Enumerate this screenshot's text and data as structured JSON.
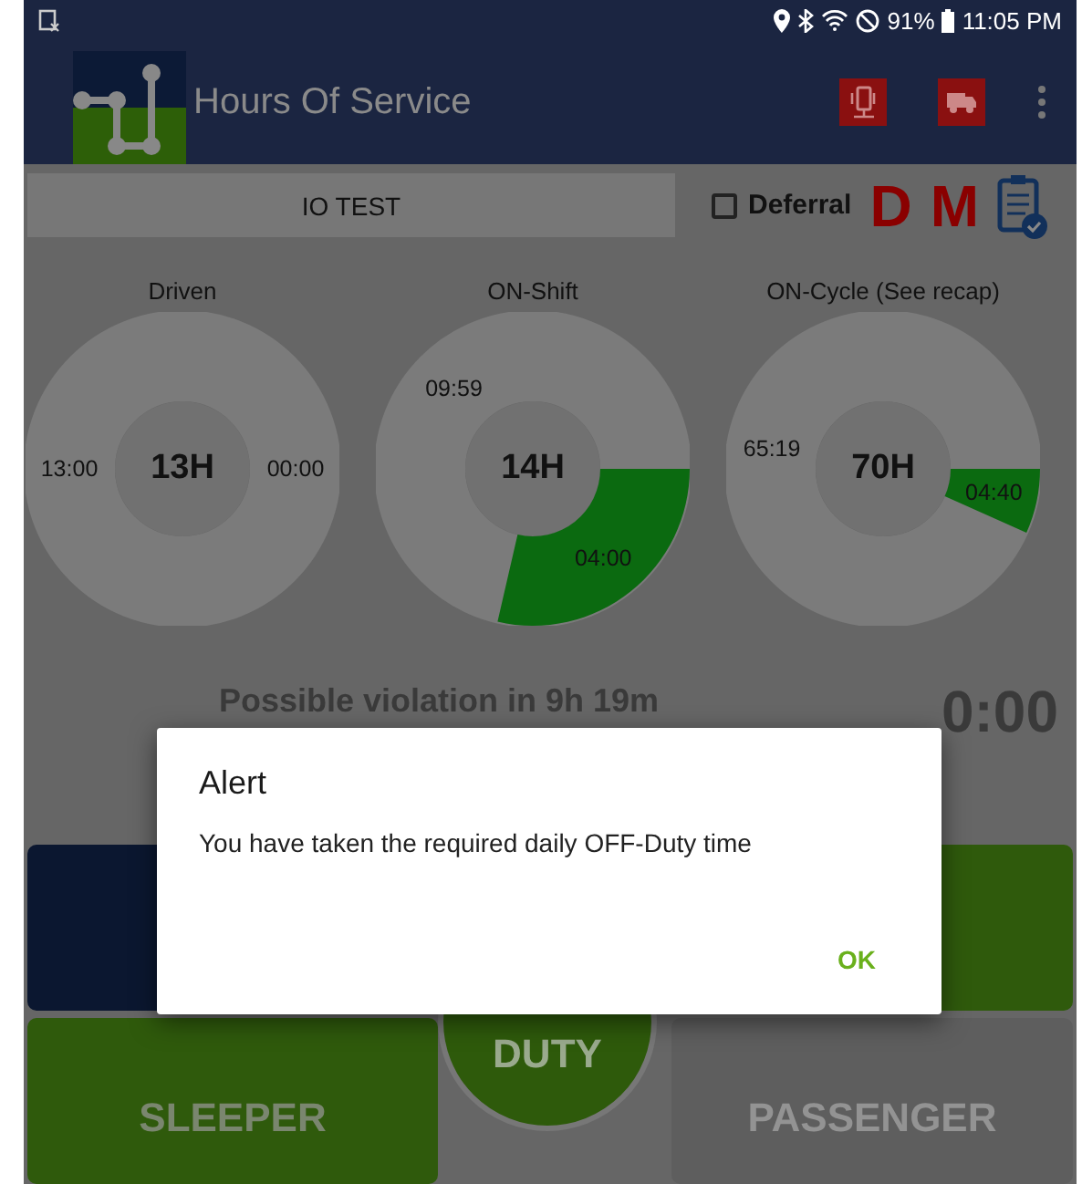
{
  "status_bar": {
    "battery": "91%",
    "time": "11:05 PM"
  },
  "app_bar": {
    "title": "Hours Of Service"
  },
  "toolbar": {
    "vehicle": "IO TEST",
    "deferral": {
      "label": "Deferral",
      "checked": false
    },
    "indicators": [
      "D",
      "M"
    ]
  },
  "gauges": [
    {
      "title": "Driven",
      "total": "13H",
      "remaining": "13:00",
      "used": "00:00"
    },
    {
      "title": "ON-Shift",
      "total": "14H",
      "remaining": "09:59",
      "used": "04:00"
    },
    {
      "title": "ON-Cycle (See recap)",
      "total": "70H",
      "remaining": "65:19",
      "used": "04:40"
    }
  ],
  "violation": "Possible violation in 9h 19m",
  "timer": "0:00",
  "duty_buttons": [
    {
      "kind": "off"
    },
    {
      "kind": "driving"
    },
    {
      "kind": "sleeper",
      "label": "SLEEPER",
      "selected": true
    },
    {
      "kind": "circle",
      "label": "DUTY"
    },
    {
      "kind": "passenger",
      "label": "PASSENGER",
      "selected": false
    }
  ],
  "dialog": {
    "title": "Alert",
    "message": "You have taken the required daily OFF-Duty time",
    "button": "OK"
  }
}
